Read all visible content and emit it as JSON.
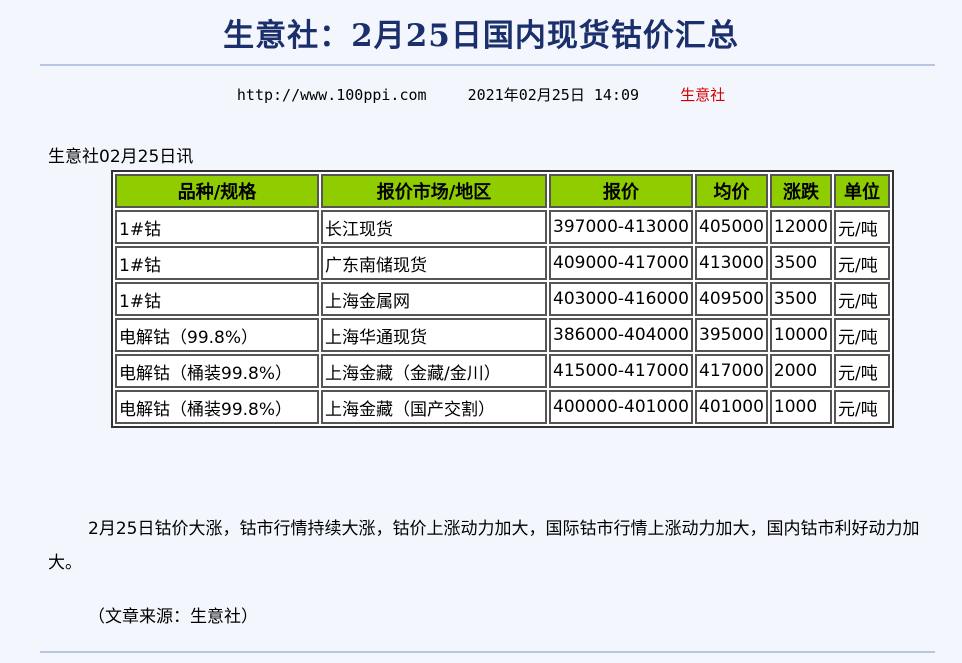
{
  "article": {
    "title": "生意社：2月25日国内现货钴价汇总",
    "url": "http://www.100ppi.com",
    "datetime": "2021年02月25日 14:09",
    "publisher": "生意社",
    "intro": "生意社02月25日讯",
    "paragraph": "2月25日钴价大涨，钴市行情持续大涨，钴价上涨动力加大，国际钴市行情上涨动力加大，国内钴市利好动力加大。",
    "source_note": "（文章来源：生意社）"
  },
  "table": {
    "headers": [
      "品种/规格",
      "报价市场/地区",
      "报价",
      "均价",
      "涨跌",
      "单位"
    ],
    "rows": [
      [
        "1#钴",
        "长江现货",
        "397000-413000",
        "405000",
        "12000",
        "元/吨"
      ],
      [
        "1#钴",
        "广东南储现货",
        "409000-417000",
        "413000",
        "3500",
        "元/吨"
      ],
      [
        "1#钴",
        "上海金属网",
        "403000-416000",
        "409500",
        "3500",
        "元/吨"
      ],
      [
        "电解钴（99.8%）",
        "上海华通现货",
        "386000-404000",
        "395000",
        "10000",
        "元/吨"
      ],
      [
        "电解钴（桶装99.8%）",
        "上海金藏（金藏/金川）",
        "415000-417000",
        "417000",
        "2000",
        "元/吨"
      ],
      [
        "电解钴（桶装99.8%）",
        "上海金藏（国产交割）",
        "400000-401000",
        "401000",
        "1000",
        "元/吨"
      ]
    ]
  },
  "colors": {
    "title": "#1a2f6b",
    "header_bg": "#8fcc00",
    "publisher": "#d40000",
    "page_bg": "#f3f7fd"
  }
}
